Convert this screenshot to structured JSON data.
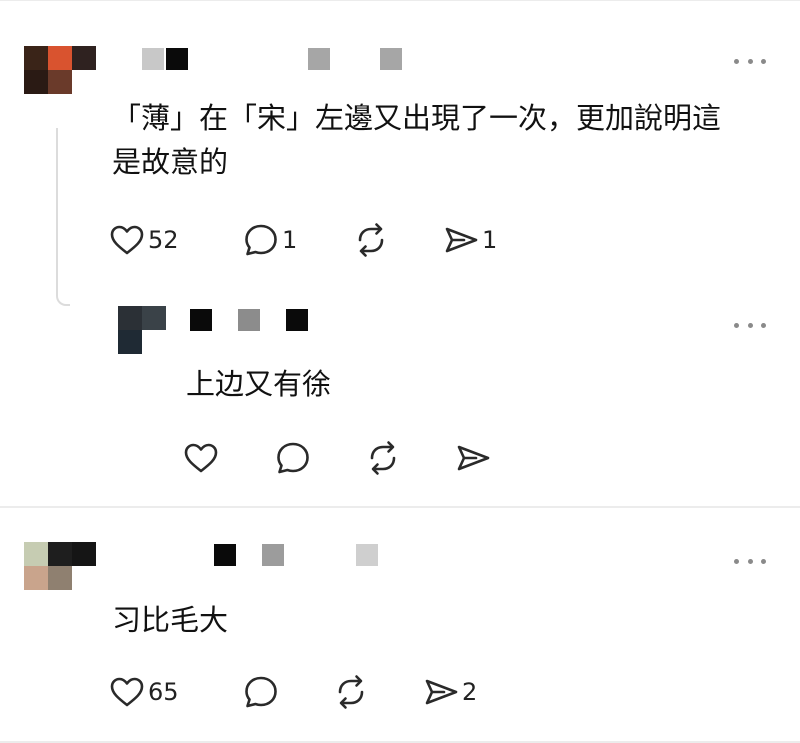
{
  "comments": [
    {
      "text": "「薄」在「宋」左邊又出現了一次，更加說明這\n是故意的",
      "likes": "52",
      "replies": "1",
      "reposts": "",
      "shares": "1",
      "avatar_colors": [
        "#3a2418",
        "#d9532f",
        "#2f2220",
        "#2a1a14",
        "#6a3a2a",
        "#ffffff"
      ],
      "name_colors": [
        "#c8c8c8",
        "#0a0a0a",
        "#a6a6a6",
        "#a6a6a6"
      ]
    },
    {
      "text": "上边又有徐",
      "likes": "",
      "replies": "",
      "reposts": "",
      "shares": "",
      "avatar_colors": [
        "#2b3036",
        "#3a4248",
        "#1f2a34",
        "#ffffff"
      ],
      "name_colors": [
        "#0a0a0a",
        "#8c8c8c",
        "#0a0a0a"
      ]
    },
    {
      "text": "习比毛大",
      "likes": "65",
      "replies": "",
      "reposts": "",
      "shares": "2",
      "avatar_colors": [
        "#c6ccb2",
        "#1e1e1e",
        "#151515",
        "#c9a48c",
        "#8f8070",
        "#ffffff"
      ],
      "name_colors": [
        "#0a0a0a",
        "#9c9c9c",
        "#cfcfcf"
      ]
    }
  ],
  "icons": {
    "like": "heart-icon",
    "reply": "comment-bubble-icon",
    "repost": "repost-icon",
    "share": "send-icon",
    "more": "more-dots-icon"
  }
}
